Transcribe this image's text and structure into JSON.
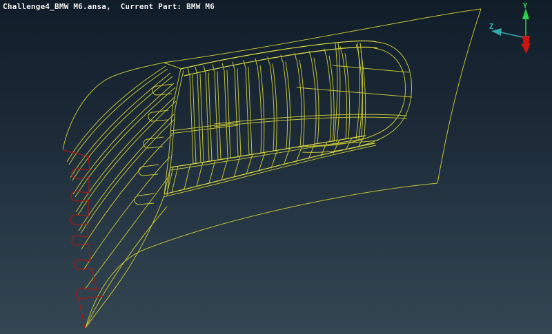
{
  "header": {
    "title": "Challenge4_BMW M6.ansa,  Current Part: BMW M6"
  },
  "triad": {
    "y_label": "Y",
    "z_label": "Z"
  },
  "colors": {
    "bg-top": "#101d29",
    "bg-mid": "#1d2b39",
    "bg-low": "#2a3b48",
    "bg-bottom": "#354653",
    "wire": "#c3c334",
    "wire-bright": "#e2e23e",
    "wire-red": "#a81812",
    "axis-y": "#2ed24a",
    "axis-z": "#35a8ae",
    "axis-x": "#cc1410",
    "title-text": "#f2f2f2"
  }
}
